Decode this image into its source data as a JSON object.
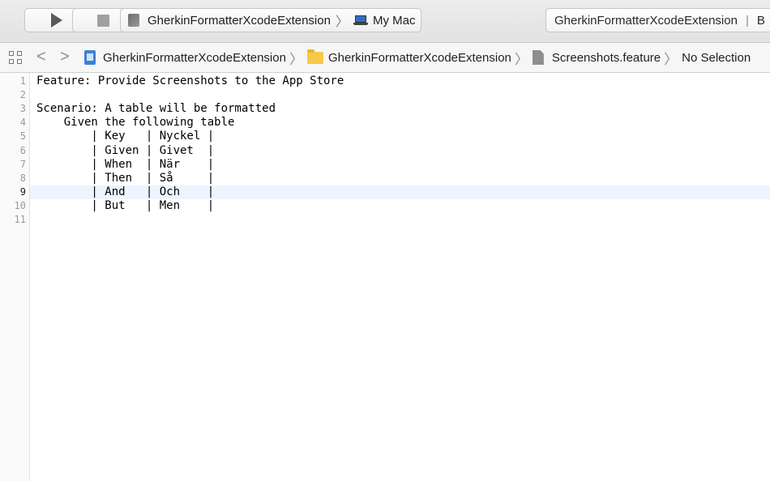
{
  "toolbar": {
    "run_icon": "play-icon",
    "stop_icon": "stop-icon",
    "scheme_target": "GherkinFormatterXcodeExtension",
    "destination": "My Mac",
    "status_text": "GherkinFormatterXcodeExtension",
    "status_text_2": "B"
  },
  "jumpbar": {
    "crumbs": [
      "GherkinFormatterXcodeExtension",
      "GherkinFormatterXcodeExtension",
      "Screenshots.feature",
      "No Selection"
    ]
  },
  "editor": {
    "current_line": 9,
    "line_numbers": [
      "1",
      "2",
      "3",
      "4",
      "5",
      "6",
      "7",
      "8",
      "9",
      "10",
      "11"
    ],
    "lines": [
      "Feature: Provide Screenshots to the App Store",
      "",
      "Scenario: A table will be formatted",
      "    Given the following table",
      "        | Key   | Nyckel |",
      "        | Given | Givet  |",
      "        | When  | När    |",
      "        | Then  | Så     |",
      "        | And   | Och    |",
      "        | But   | Men    |",
      ""
    ]
  },
  "colors": {
    "current_line_highlight": "#ecf5ff",
    "toolbar_bg": "#e6e6e6"
  }
}
